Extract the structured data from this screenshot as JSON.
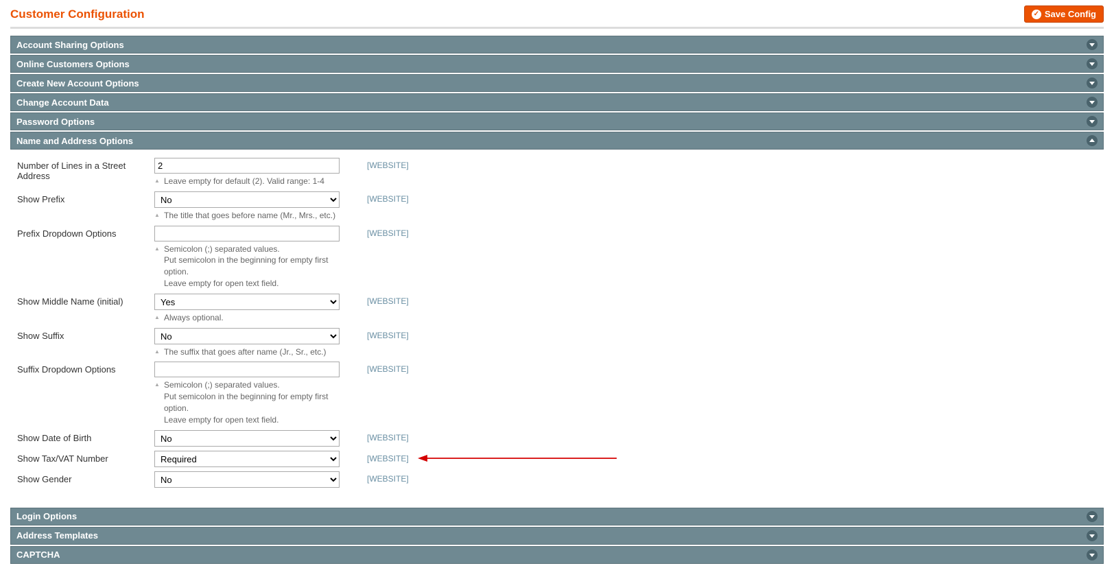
{
  "header": {
    "title": "Customer Configuration",
    "save_button_label": "Save Config"
  },
  "sections": {
    "account_sharing": "Account Sharing Options",
    "online_customers": "Online Customers Options",
    "create_account": "Create New Account Options",
    "change_account": "Change Account Data",
    "password": "Password Options",
    "name_address": "Name and Address Options",
    "login": "Login Options",
    "address_templates": "Address Templates",
    "captcha": "CAPTCHA"
  },
  "scope_label": "[WEBSITE]",
  "fields": {
    "lines": {
      "label": "Number of Lines in a Street Address",
      "value": "2",
      "hint": "Leave empty for default (2). Valid range: 1-4"
    },
    "show_prefix": {
      "label": "Show Prefix",
      "value": "No",
      "hint": "The title that goes before name (Mr., Mrs., etc.)"
    },
    "prefix_options": {
      "label": "Prefix Dropdown Options",
      "value": "",
      "hint": "Semicolon (;) separated values.\nPut semicolon in the beginning for empty first option.\nLeave empty for open text field."
    },
    "show_middle": {
      "label": "Show Middle Name (initial)",
      "value": "Yes",
      "hint": "Always optional."
    },
    "show_suffix": {
      "label": "Show Suffix",
      "value": "No",
      "hint": "The suffix that goes after name (Jr., Sr., etc.)"
    },
    "suffix_options": {
      "label": "Suffix Dropdown Options",
      "value": "",
      "hint": "Semicolon (;) separated values.\nPut semicolon in the beginning for empty first option.\nLeave empty for open text field."
    },
    "show_dob": {
      "label": "Show Date of Birth",
      "value": "No"
    },
    "show_tax": {
      "label": "Show Tax/VAT Number",
      "value": "Required"
    },
    "show_gender": {
      "label": "Show Gender",
      "value": "No"
    }
  }
}
